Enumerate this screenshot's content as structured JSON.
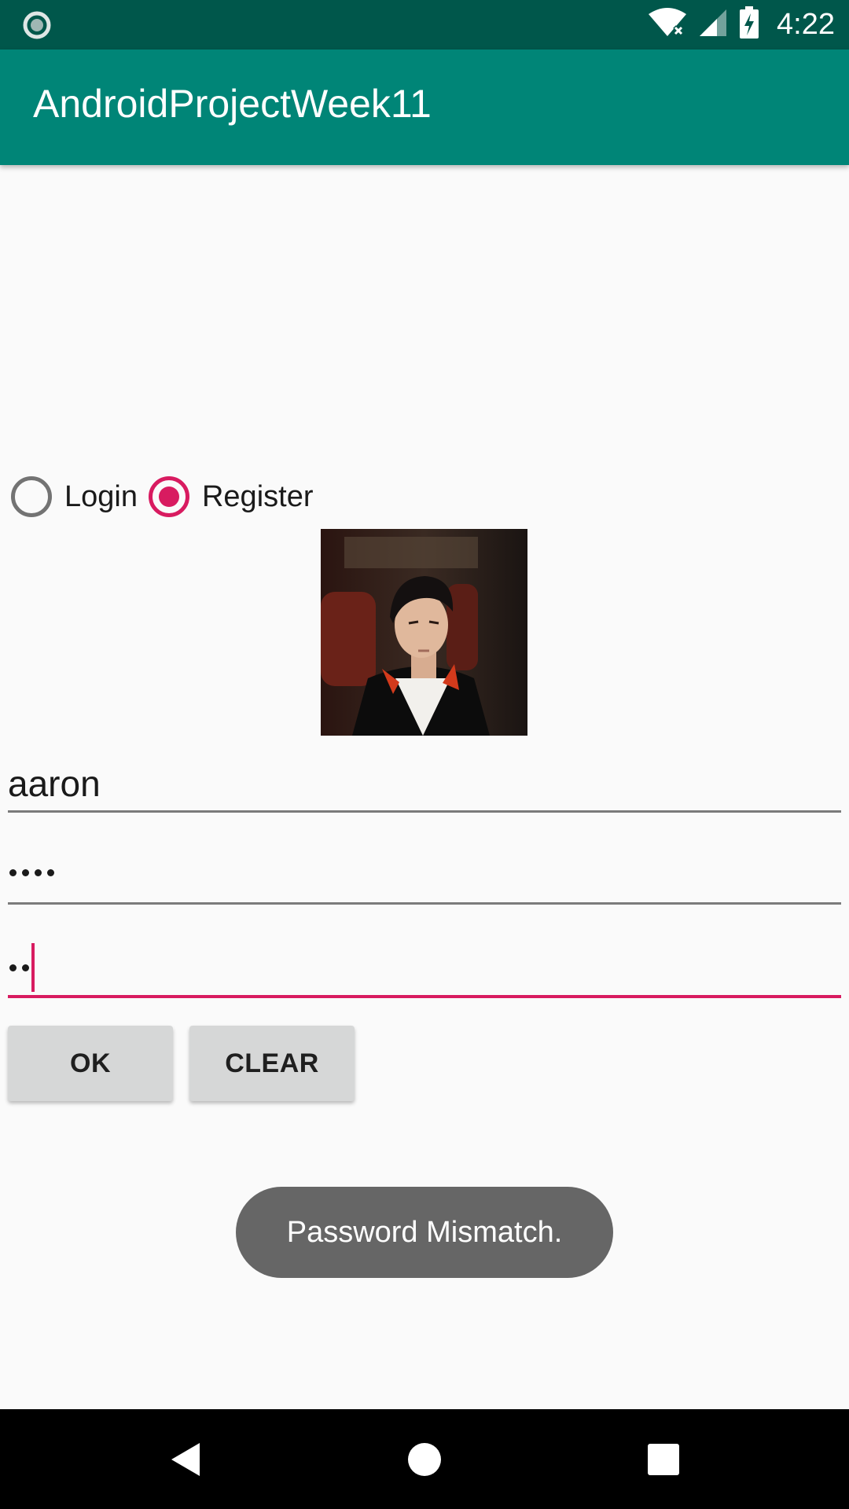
{
  "status_bar": {
    "time": "4:22",
    "left_icon": "notification-dot-icon",
    "icons": [
      "wifi-icon",
      "cell-signal-icon",
      "battery-charging-icon"
    ],
    "background": "#00574b"
  },
  "app_bar": {
    "title": "AndroidProjectWeek11",
    "background": "#008577"
  },
  "mode_selector": {
    "options": [
      {
        "label": "Login",
        "selected": false
      },
      {
        "label": "Register",
        "selected": true
      }
    ],
    "accent": "#d81b60"
  },
  "avatar": {
    "icon": "profile-photo"
  },
  "form": {
    "username": {
      "value": "aaron"
    },
    "password": {
      "masked_length": 4
    },
    "confirm_password": {
      "masked_length": 2,
      "focused": true
    }
  },
  "buttons": {
    "ok_label": "OK",
    "clear_label": "CLEAR"
  },
  "toast": {
    "message": "Password Mismatch."
  },
  "nav_bar": {
    "icons": [
      "back-icon",
      "home-icon",
      "recents-icon"
    ]
  }
}
